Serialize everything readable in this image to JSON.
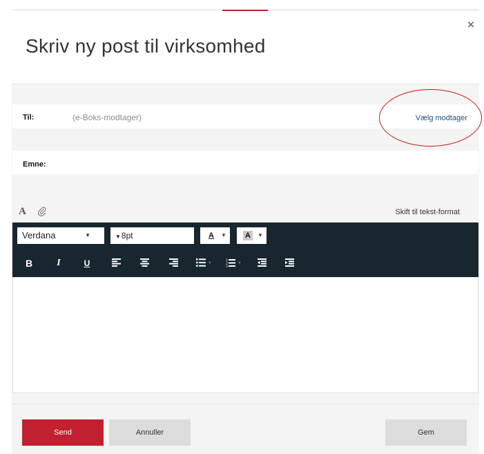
{
  "dialog": {
    "title": "Skriv ny post til virksomhed",
    "close_symbol": "×"
  },
  "recipient": {
    "label": "Til:",
    "placeholder": "(e-Boks-modtager)",
    "choose_link": "Vælg modtager"
  },
  "subject": {
    "label": "Emne:",
    "value": ""
  },
  "format_bar": {
    "text_format_icon": "font-format-icon",
    "attachment_icon": "paperclip-icon",
    "switch_label": "Skift til tekst-format"
  },
  "editor_toolbar": {
    "font_family": "Verdana",
    "font_size": "8pt",
    "font_color_glyph": "A",
    "highlight_glyph": "A",
    "bold_glyph": "B",
    "italic_glyph": "I",
    "underline_glyph": "U"
  },
  "footer": {
    "send_label": "Send",
    "cancel_label": "Annuller",
    "save_label": "Gem"
  },
  "colors": {
    "accent": "#c0202f",
    "toolbar_bg": "#17262f",
    "link": "#1f4f7a",
    "annotation_circle": "#d0151b"
  }
}
